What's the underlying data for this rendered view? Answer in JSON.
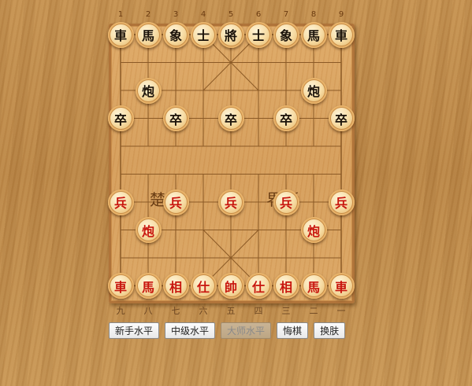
{
  "top_numbers": [
    "1",
    "2",
    "3",
    "4",
    "5",
    "6",
    "7",
    "8",
    "9"
  ],
  "bottom_labels": [
    "九",
    "八",
    "七",
    "六",
    "五",
    "四",
    "三",
    "二",
    "一"
  ],
  "river": {
    "left": "楚河",
    "right": "汉界"
  },
  "pieces": [
    {
      "label": "車",
      "side": "black",
      "col": 0,
      "row": 0
    },
    {
      "label": "馬",
      "side": "black",
      "col": 1,
      "row": 0
    },
    {
      "label": "象",
      "side": "black",
      "col": 2,
      "row": 0
    },
    {
      "label": "士",
      "side": "black",
      "col": 3,
      "row": 0
    },
    {
      "label": "將",
      "side": "black",
      "col": 4,
      "row": 0
    },
    {
      "label": "士",
      "side": "black",
      "col": 5,
      "row": 0
    },
    {
      "label": "象",
      "side": "black",
      "col": 6,
      "row": 0
    },
    {
      "label": "馬",
      "side": "black",
      "col": 7,
      "row": 0
    },
    {
      "label": "車",
      "side": "black",
      "col": 8,
      "row": 0
    },
    {
      "label": "炮",
      "side": "black",
      "col": 1,
      "row": 2
    },
    {
      "label": "炮",
      "side": "black",
      "col": 7,
      "row": 2
    },
    {
      "label": "卒",
      "side": "black",
      "col": 0,
      "row": 3
    },
    {
      "label": "卒",
      "side": "black",
      "col": 2,
      "row": 3
    },
    {
      "label": "卒",
      "side": "black",
      "col": 4,
      "row": 3
    },
    {
      "label": "卒",
      "side": "black",
      "col": 6,
      "row": 3
    },
    {
      "label": "卒",
      "side": "black",
      "col": 8,
      "row": 3
    },
    {
      "label": "兵",
      "side": "red",
      "col": 0,
      "row": 6
    },
    {
      "label": "兵",
      "side": "red",
      "col": 2,
      "row": 6
    },
    {
      "label": "兵",
      "side": "red",
      "col": 4,
      "row": 6
    },
    {
      "label": "兵",
      "side": "red",
      "col": 6,
      "row": 6
    },
    {
      "label": "兵",
      "side": "red",
      "col": 8,
      "row": 6
    },
    {
      "label": "炮",
      "side": "red",
      "col": 1,
      "row": 7
    },
    {
      "label": "炮",
      "side": "red",
      "col": 7,
      "row": 7
    },
    {
      "label": "車",
      "side": "red",
      "col": 0,
      "row": 9
    },
    {
      "label": "馬",
      "side": "red",
      "col": 1,
      "row": 9
    },
    {
      "label": "相",
      "side": "red",
      "col": 2,
      "row": 9
    },
    {
      "label": "仕",
      "side": "red",
      "col": 3,
      "row": 9
    },
    {
      "label": "帥",
      "side": "red",
      "col": 4,
      "row": 9
    },
    {
      "label": "仕",
      "side": "red",
      "col": 5,
      "row": 9
    },
    {
      "label": "相",
      "side": "red",
      "col": 6,
      "row": 9
    },
    {
      "label": "馬",
      "side": "red",
      "col": 7,
      "row": 9
    },
    {
      "label": "車",
      "side": "red",
      "col": 8,
      "row": 9
    }
  ],
  "buttons": [
    {
      "label": "新手水平",
      "enabled": true
    },
    {
      "label": "中级水平",
      "enabled": true
    },
    {
      "label": "大师水平",
      "enabled": false
    },
    {
      "label": "悔棋",
      "enabled": true
    },
    {
      "label": "换肤",
      "enabled": true
    }
  ],
  "colors": {
    "red_piece": "#c8160e",
    "black_piece": "#1a1209",
    "grid_line": "#8b5a26"
  }
}
